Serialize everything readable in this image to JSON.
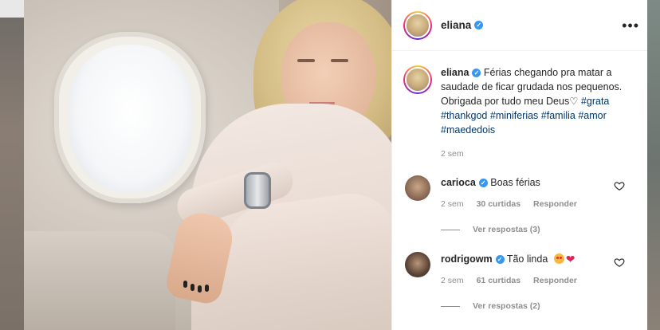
{
  "post": {
    "username": "eliana",
    "verified_mark": "✓",
    "more_icon": "more-horizontal-icon",
    "caption": {
      "username": "eliana",
      "text": "Férias chegando pra matar a saudade de ficar grudada nos pequenos. Obrigada por tudo meu Deus",
      "heart": "♡",
      "hashtags": [
        "#grata",
        "#thankgod",
        "#miniferias",
        "#familia",
        "#amor",
        "#maededois"
      ],
      "time": "2 sem"
    },
    "comments": [
      {
        "username": "carioca",
        "text": "Boas férias",
        "time": "2 sem",
        "likes": "30 curtidas",
        "reply": "Responder",
        "view_replies": "Ver respostas (3)",
        "avatar_color": "#8b6b55"
      },
      {
        "username": "rodrigowm",
        "text": "Tão linda",
        "emoji": [
          "smiling-face-with-heart-eyes",
          "red-heart"
        ],
        "time": "2 sem",
        "likes": "61 curtidas",
        "reply": "Responder",
        "view_replies": "Ver respostas (2)",
        "avatar_color": "#5a4436"
      }
    ]
  },
  "colors": {
    "link": "#00376b",
    "secondary_text": "#8e8e8e",
    "verified": "#3897f0",
    "heart": "#e0245e"
  }
}
